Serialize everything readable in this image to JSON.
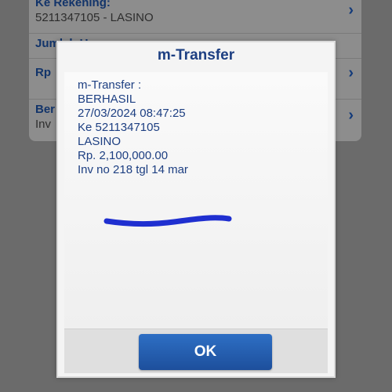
{
  "background_list": {
    "rows": [
      {
        "label": "Ke Rekening:",
        "value": "5211347105 - LASINO"
      },
      {
        "label": "Jumlah Uang",
        "value": ""
      },
      {
        "label": "Rp",
        "value": ""
      },
      {
        "label": "Ber",
        "value": "Inv"
      }
    ]
  },
  "dialog": {
    "title": "m-Transfer",
    "lines": [
      "m-Transfer :",
      "BERHASIL",
      "27/03/2024 08:47:25",
      "Ke 5211347105",
      "LASINO",
      "Rp. 2,100,000.00",
      "Inv no 218 tgl 14 mar"
    ],
    "ok_label": "OK"
  },
  "colors": {
    "title": "#1d3f82",
    "ok_button": "#2462b8",
    "scribble": "#1f2fd0"
  }
}
